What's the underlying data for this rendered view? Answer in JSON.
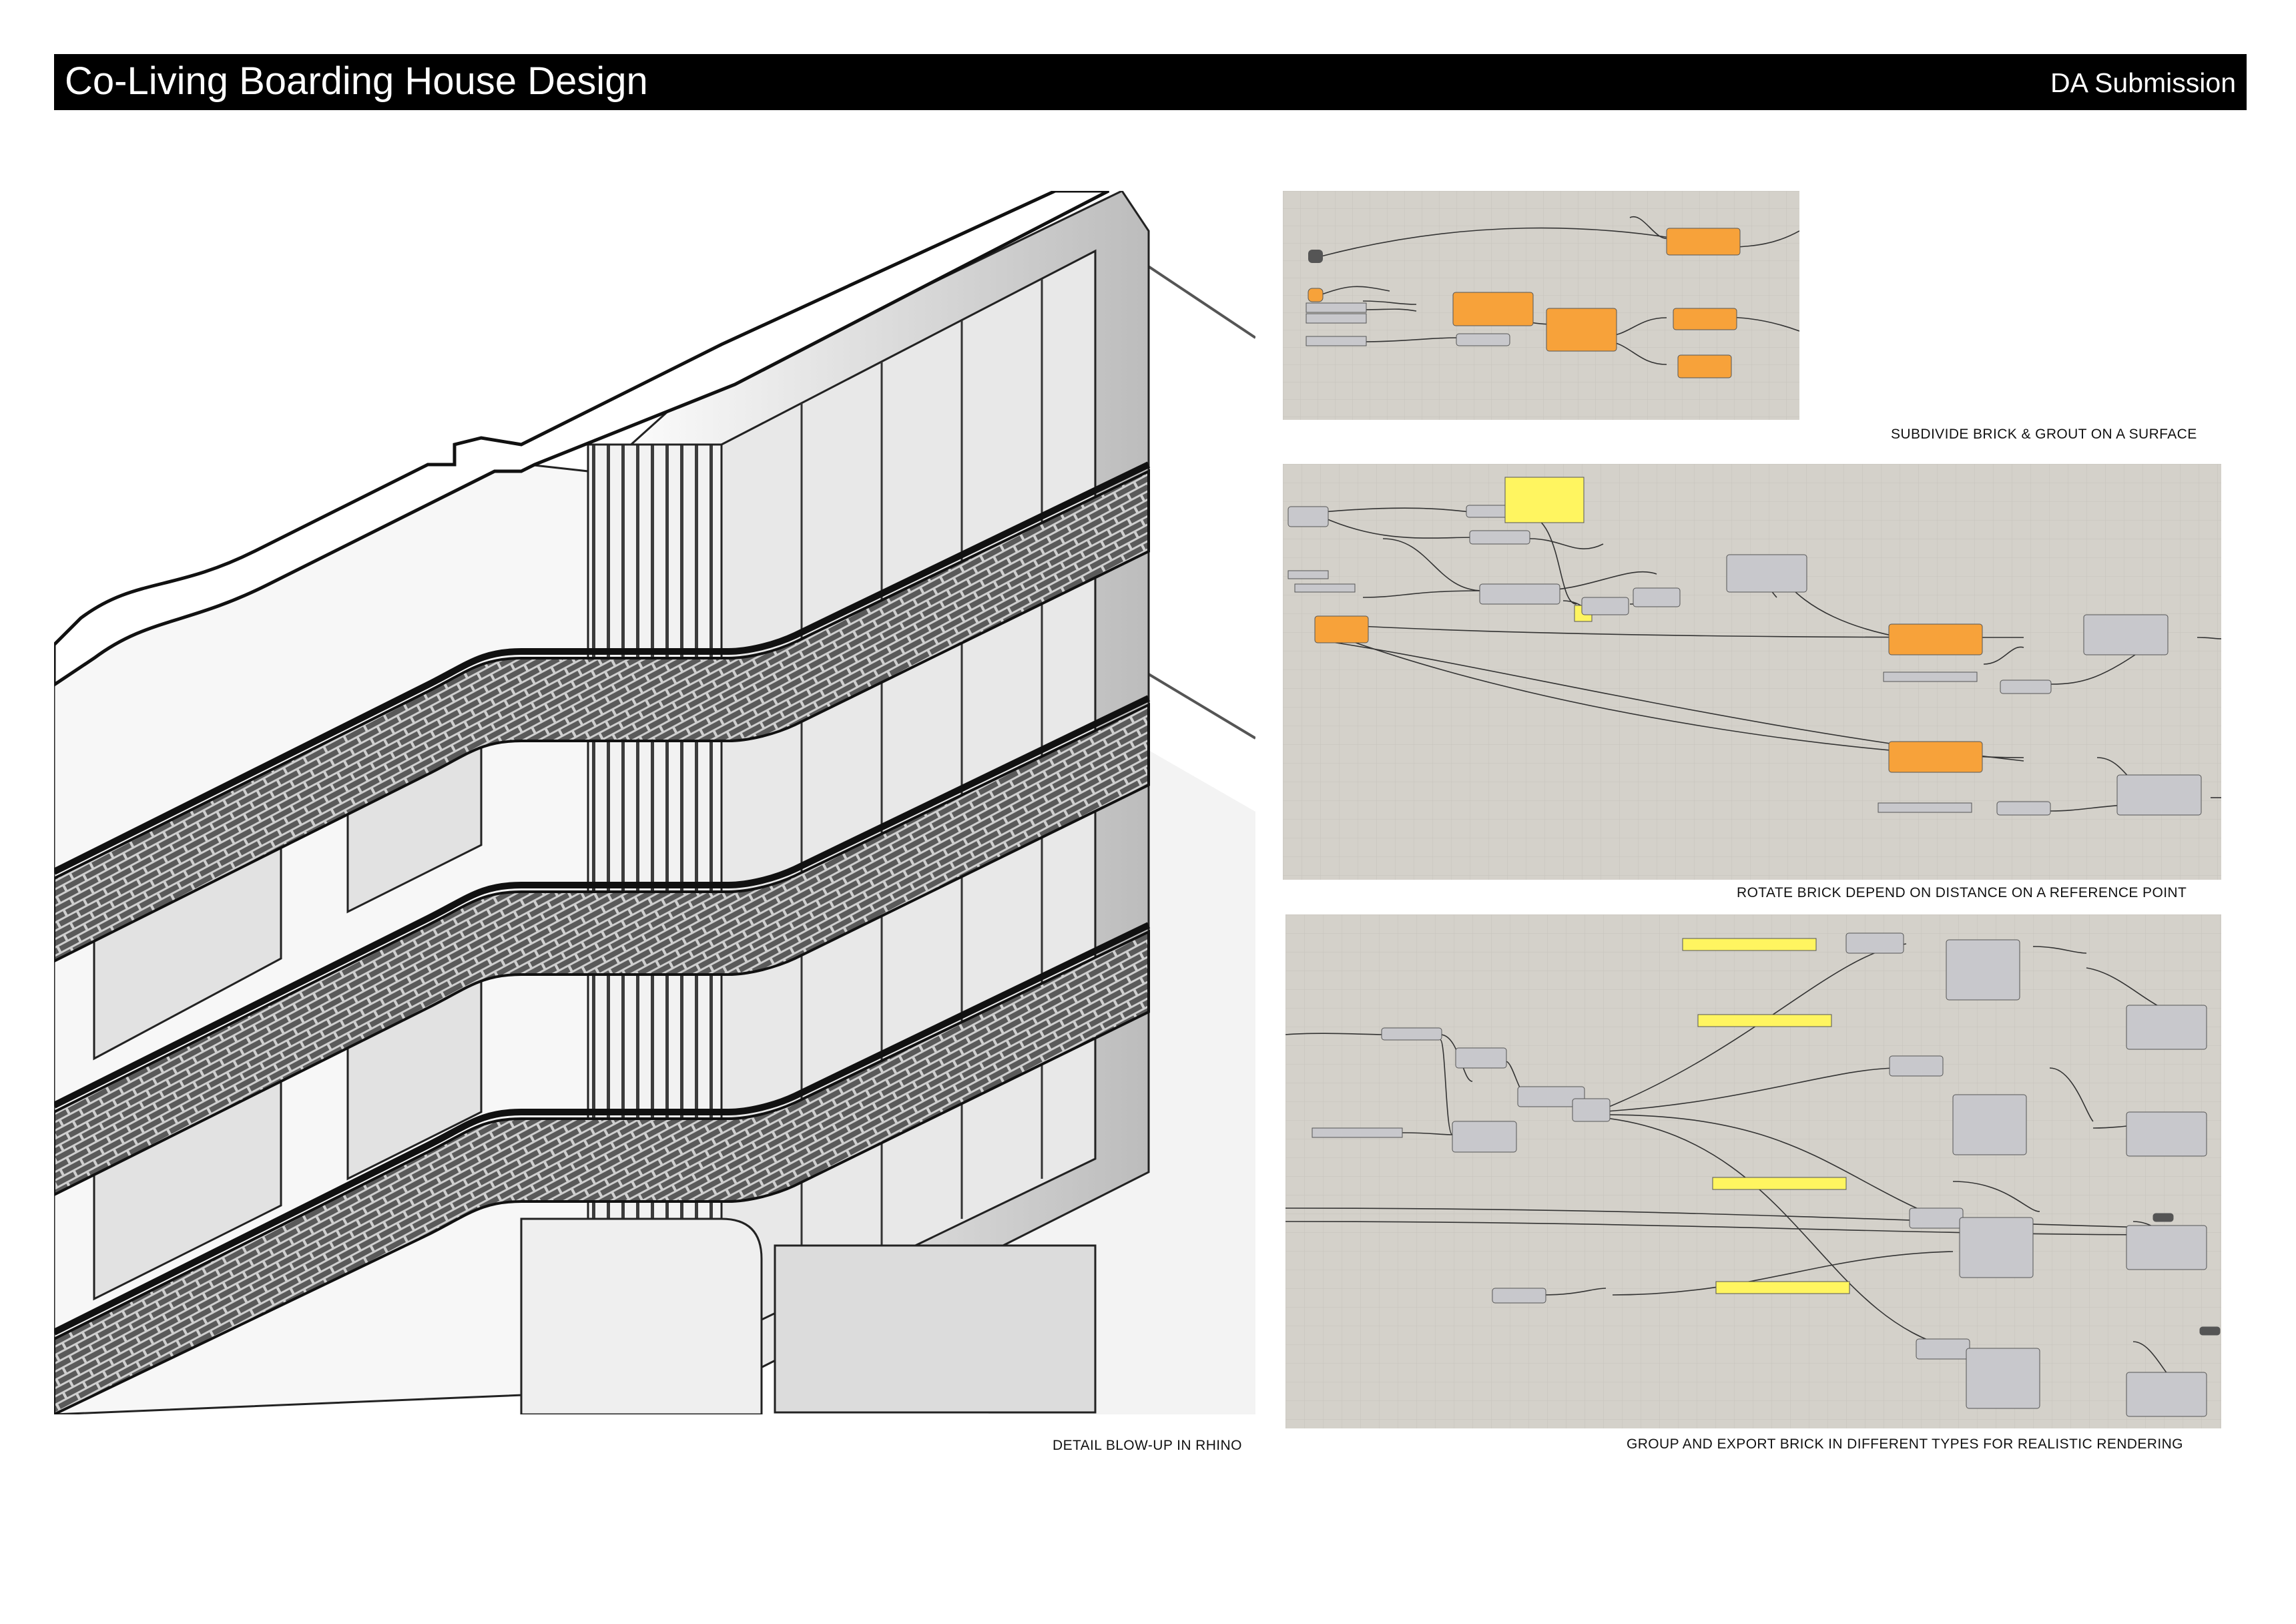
{
  "header": {
    "title": "Co-Living Boarding House Design",
    "subtitle": "DA Submission"
  },
  "captions": {
    "rhino_detail": "DETAIL BLOW-UP IN RHINO",
    "subdivide": "SUBDIVIDE BRICK & GROUT ON A SURFACE",
    "rotate": "ROTATE BRICK DEPEND ON DISTANCE ON A REFERENCE POINT",
    "group_export": "GROUP AND EXPORT BRICK IN DIFFERENT TYPES FOR REALISTIC RENDERING"
  },
  "colors": {
    "canvas": "#d4d1ca",
    "component_orange": "#f7a23a",
    "component_grey": "#c8c8cc",
    "panel_yellow": "#fff560",
    "wire": "#333333"
  }
}
